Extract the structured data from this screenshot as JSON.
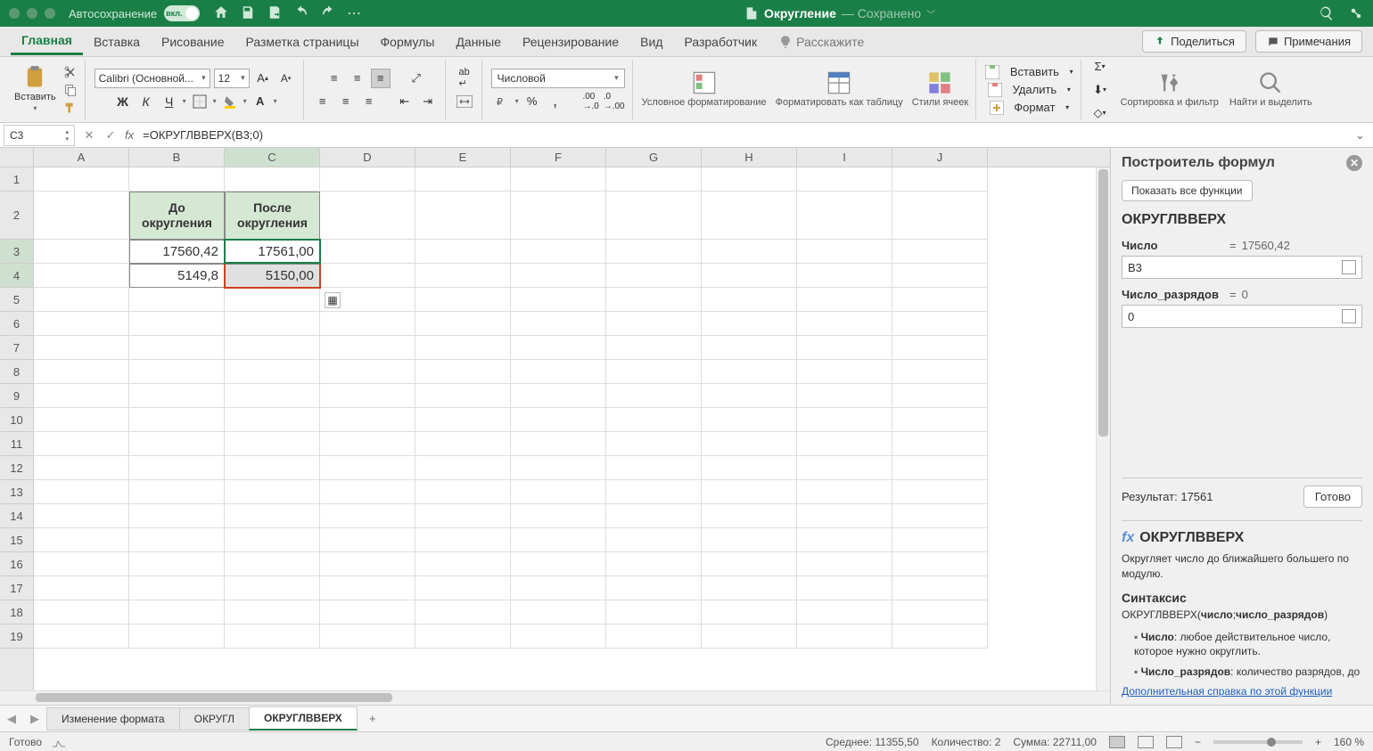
{
  "titlebar": {
    "autosave_label": "Автосохранение",
    "autosave_state": "вкл.",
    "filename": "Округление",
    "saved_state": "— Сохранено"
  },
  "tabs": {
    "items": [
      "Главная",
      "Вставка",
      "Рисование",
      "Разметка страницы",
      "Формулы",
      "Данные",
      "Рецензирование",
      "Вид",
      "Разработчик"
    ],
    "tell_me": "Расскажите",
    "share": "Поделиться",
    "comments": "Примечания"
  },
  "ribbon": {
    "paste": "Вставить",
    "font_name": "Calibri (Основной...",
    "font_size": "12",
    "number_format": "Числовой",
    "cond_fmt": "Условное форматирование",
    "fmt_table": "Форматировать как таблицу",
    "cell_styles": "Стили ячеек",
    "insert": "Вставить",
    "delete": "Удалить",
    "format": "Формат",
    "sort_filter": "Сортировка и фильтр",
    "find_select": "Найти и выделить"
  },
  "formula_bar": {
    "cell_ref": "C3",
    "formula": "=ОКРУГЛВВЕРХ(B3;0)"
  },
  "grid": {
    "columns": [
      "A",
      "B",
      "C",
      "D",
      "E",
      "F",
      "G",
      "H",
      "I",
      "J"
    ],
    "selected_cols": [
      "C"
    ],
    "selected_rows": [
      3,
      4
    ],
    "header_b": "До округления",
    "header_c": "После округления",
    "b3": "17560,42",
    "c3": "17561,00",
    "b4": "5149,8",
    "c4": "5150,00"
  },
  "formula_pane": {
    "title": "Построитель формул",
    "show_all": "Показать все функции",
    "func_name": "ОКРУГЛВВЕРХ",
    "arg1_label": "Число",
    "arg1_preview": "17560,42",
    "arg1_value": "B3",
    "arg2_label": "Число_разрядов",
    "arg2_preview": "0",
    "arg2_value": "0",
    "result_label": "Результат: 17561",
    "done": "Готово",
    "desc_title": "ОКРУГЛВВЕРХ",
    "desc_text": "Округляет число до ближайшего большего по модулю.",
    "syntax_h": "Синтаксис",
    "syntax": "ОКРУГЛВВЕРХ(число;число_разрядов)",
    "b1_bold": "Число",
    "b1_text": ": любое действительное число, которое нужно округлить.",
    "b2_bold": "Число_разрядов",
    "b2_text": ": количество разрядов, до",
    "help_link": "Дополнительная справка по этой функции"
  },
  "sheets": {
    "items": [
      "Изменение формата",
      "ОКРУГЛ",
      "ОКРУГЛВВЕРХ"
    ],
    "active_index": 2
  },
  "status": {
    "ready": "Готово",
    "avg_label": "Среднее:",
    "avg_val": "11355,50",
    "count_label": "Количество:",
    "count_val": "2",
    "sum_label": "Сумма:",
    "sum_val": "22711,00",
    "zoom": "160 %"
  }
}
